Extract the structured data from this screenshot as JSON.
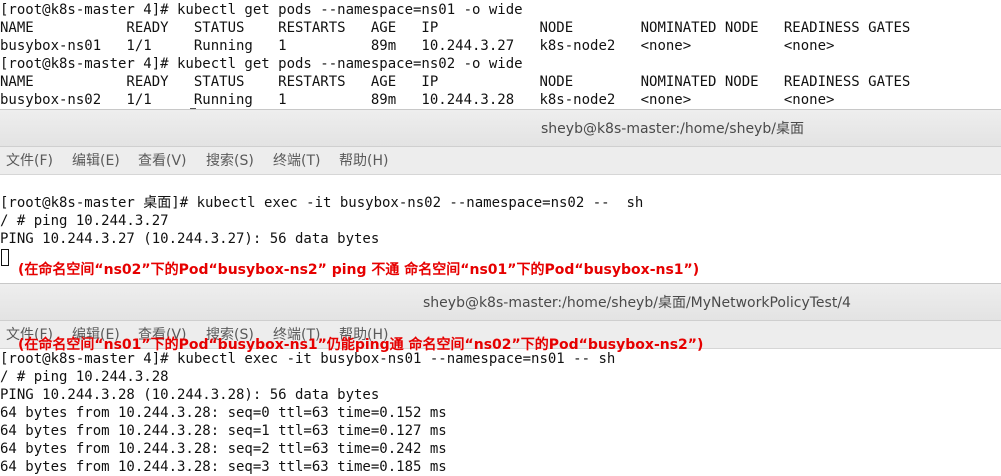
{
  "top_terminal": {
    "lines": [
      "[root@k8s-master 4]# kubectl get pods --namespace=ns01 -o wide",
      "NAME           READY   STATUS    RESTARTS   AGE   IP            NODE        NOMINATED NODE   READINESS GATES",
      "busybox-ns01   1/1     Running   1          89m   10.244.3.27   k8s-node2   <none>           <none>",
      "[root@k8s-master 4]# kubectl get pods --namespace=ns02 -o wide",
      "NAME           READY   STATUS    RESTARTS   AGE   IP            NODE        NOMINATED NODE   READINESS GATES",
      "busybox-ns02   1/1     Running   1          89m   10.244.3.28   k8s-node2   <none>           <none>"
    ]
  },
  "window1": {
    "title": "sheyb@k8s-master:/home/sheyb/桌面",
    "menu": [
      "文件(F)",
      "编辑(E)",
      "查看(V)",
      "搜索(S)",
      "终端(T)",
      "帮助(H)"
    ],
    "lines": [
      "[root@k8s-master 桌面]# kubectl exec -it busybox-ns02 --namespace=ns02 --  sh",
      "/ # ping 10.244.3.27",
      "PING 10.244.3.27 (10.244.3.27): 56 data bytes"
    ],
    "annotation": "(在命名空间“ns02”下的Pod“busybox-ns2” ping 不通 命名空间“ns01”下的Pod“busybox-ns1”)"
  },
  "window2": {
    "title": "sheyb@k8s-master:/home/sheyb/桌面/MyNetworkPolicyTest/4",
    "menu": [
      "文件(F)",
      "编辑(E)",
      "查看(V)",
      "搜索(S)",
      "终端(T)",
      "帮助(H)"
    ],
    "annotation": "(在命名空间“ns01”下的Pod“busybox-ns1”仍能ping通 命名空间“ns02”下的Pod“busybox-ns2”)",
    "lines": [
      "[root@k8s-master 4]# kubectl exec -it busybox-ns01 --namespace=ns01 -- sh",
      "/ # ping 10.244.3.28",
      "PING 10.244.3.28 (10.244.3.28): 56 data bytes",
      "64 bytes from 10.244.3.28: seq=0 ttl=63 time=0.152 ms",
      "64 bytes from 10.244.3.28: seq=1 ttl=63 time=0.127 ms",
      "64 bytes from 10.244.3.28: seq=2 ttl=63 time=0.242 ms",
      "64 bytes from 10.244.3.28: seq=3 ttl=63 time=0.185 ms"
    ]
  }
}
